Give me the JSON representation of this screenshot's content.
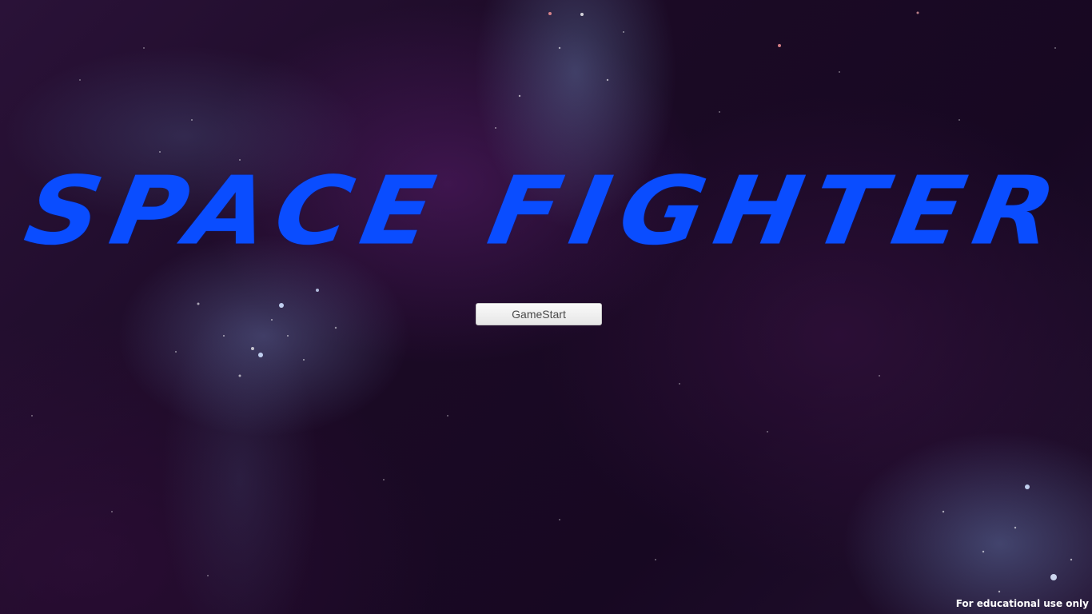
{
  "game": {
    "title": "SPACE FIGHTER",
    "start_button_label": "GameStart",
    "watermark": "For educational use only"
  },
  "colors": {
    "title": "#0a4dff",
    "background": "#1b0a25",
    "button_bg": "#f0f0f0",
    "button_text": "#4a4a4a"
  }
}
